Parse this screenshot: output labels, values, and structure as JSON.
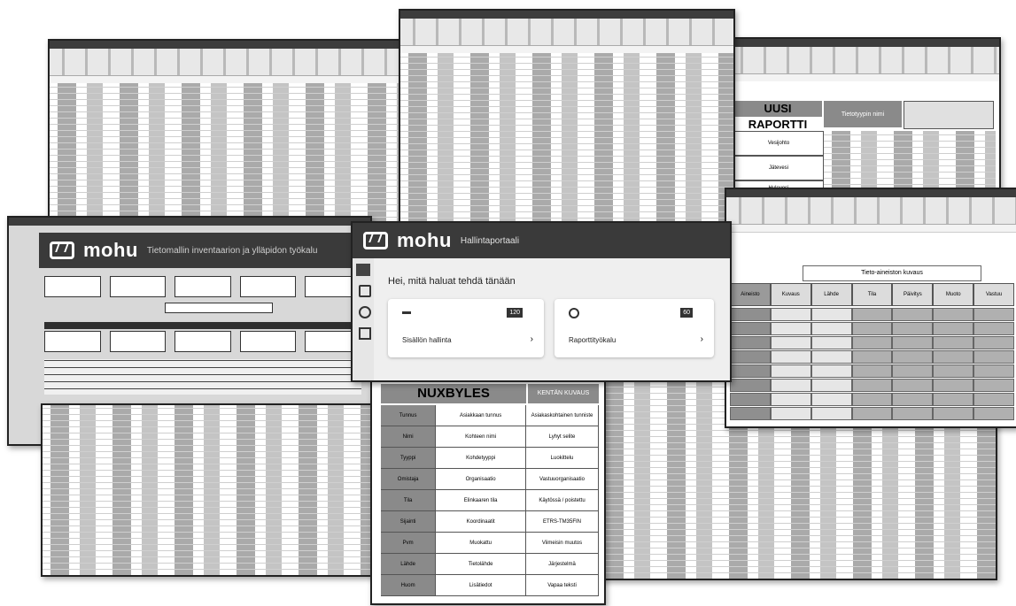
{
  "windows": {
    "mohu_main": {
      "brand": "mohu",
      "tagline": "Tietomallin inventaarion ja ylläpidon työkalu"
    },
    "mohu_app": {
      "brand": "mohu",
      "section": "Hallintaportaali",
      "heading": "Hei, mitä haluat tehdä tänään",
      "cards": [
        {
          "label": "Sisällön hallinta",
          "badge": "120"
        },
        {
          "label": "Raporttityökalu",
          "badge": "60"
        }
      ]
    },
    "uusi_table": {
      "title": "UUSI RAPORTTI",
      "col_header": "Tietotyypin nimi",
      "rows": [
        "Vesijohto",
        "Jätevesi",
        "Hulevesi"
      ]
    },
    "nuxbyles": {
      "title": "NUXBYLES",
      "right_header": "KENTÄN KUVAUS",
      "rows": [
        {
          "left": "Tunnus",
          "mid": "Asiakkaan tunnus",
          "right": "Asiakaskohtainen tunniste"
        },
        {
          "left": "Nimi",
          "mid": "Kohteen nimi",
          "right": "Lyhyt selite"
        },
        {
          "left": "Tyyppi",
          "mid": "Kohdetyyppi",
          "right": "Luokittelu"
        },
        {
          "left": "Omistaja",
          "mid": "Organisaatio",
          "right": "Vastuuorganisaatio"
        },
        {
          "left": "Tila",
          "mid": "Elinkaaren tila",
          "right": "Käytössä / poistettu"
        },
        {
          "left": "Sijainti",
          "mid": "Koordinaatit",
          "right": "ETRS-TM35FIN"
        },
        {
          "left": "Pvm",
          "mid": "Muokattu",
          "right": "Viimeisin muutos"
        },
        {
          "left": "Lähde",
          "mid": "Tietolähde",
          "right": "Järjestelmä"
        },
        {
          "left": "Huom",
          "mid": "Lisätiedot",
          "right": "Vapaa teksti"
        }
      ]
    },
    "right_table": {
      "title": "Tieto-aineiston kuvaus",
      "headers": [
        "Aineisto",
        "Kuvaus",
        "Lähde",
        "Tila",
        "Päivitys",
        "Muoto",
        "Vastuu"
      ]
    }
  }
}
